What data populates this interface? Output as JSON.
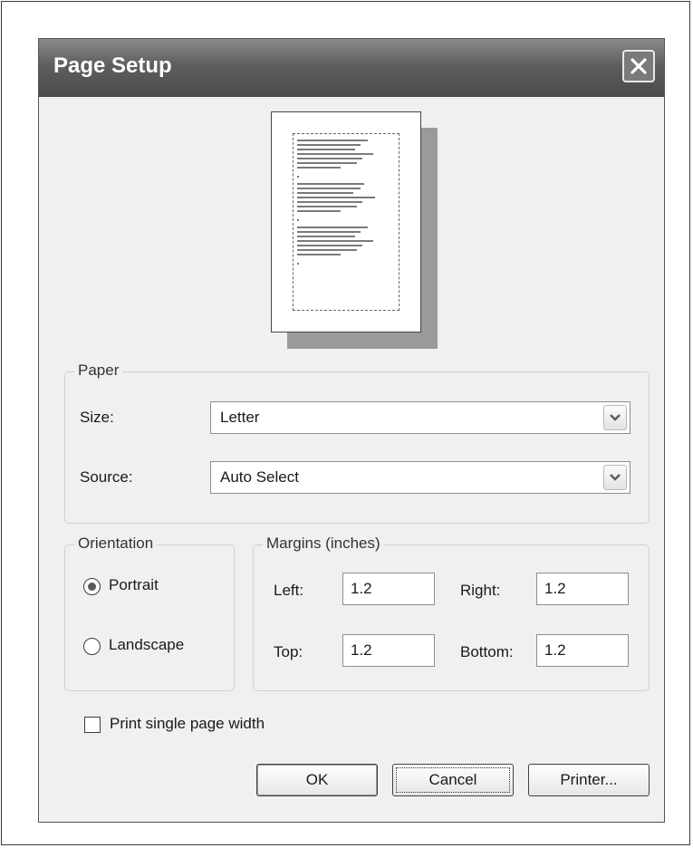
{
  "dialog": {
    "title": "Page Setup",
    "close_icon": "close-icon"
  },
  "preview": {
    "icon": "page-preview"
  },
  "paper": {
    "legend": "Paper",
    "size_label": "Size:",
    "size_value": "Letter",
    "source_label": "Source:",
    "source_value": "Auto Select"
  },
  "orientation": {
    "legend": "Orientation",
    "portrait_label": "Portrait",
    "landscape_label": "Landscape",
    "selected": "Portrait"
  },
  "margins": {
    "legend": "Margins (inches)",
    "left_label": "Left:",
    "left_value": "1.2",
    "right_label": "Right:",
    "right_value": "1.2",
    "top_label": "Top:",
    "top_value": "1.2",
    "bottom_label": "Bottom:",
    "bottom_value": "1.2"
  },
  "options": {
    "print_single_page_width_label": "Print single page width",
    "print_single_page_width_checked": false
  },
  "buttons": {
    "ok": "OK",
    "cancel": "Cancel",
    "printer": "Printer..."
  }
}
